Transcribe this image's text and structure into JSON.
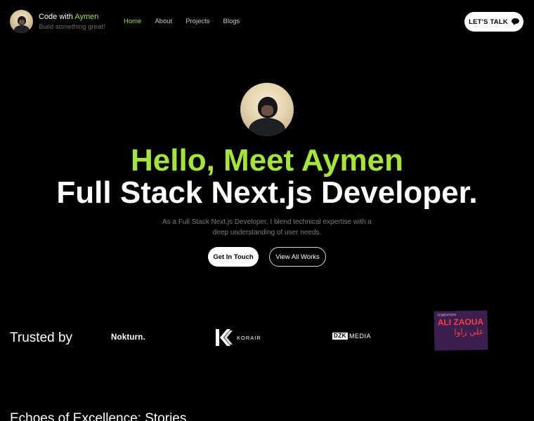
{
  "header": {
    "brand": {
      "prefix": "Code with ",
      "name": "Aymen",
      "tagline": "Build something great!"
    },
    "nav": [
      {
        "label": "Home",
        "active": true
      },
      {
        "label": "About",
        "active": false
      },
      {
        "label": "Projects",
        "active": false
      },
      {
        "label": "Blogs",
        "active": false
      }
    ],
    "cta_label": "LET'S TALK",
    "cta_icon": "chat-icon"
  },
  "hero": {
    "greeting": "Hello, Meet Aymen",
    "role": "Full Stack Next.js Developer.",
    "description": "As a Full Stack Next.js Developer, I blend technical expertise with a deep understanding of user needs.",
    "primary_button": "Get In Touch",
    "secondary_button": "View All Works"
  },
  "trusted": {
    "title": "Trusted by",
    "logos": {
      "nokturn": "Nokturn.",
      "korair": "KORAIR",
      "dzk_mark": "DZK",
      "dzk_word": "MEDIA",
      "ali_top": "FONDATION",
      "ali_main": "ALI ZAOUA",
      "ali_ar": "علي زاوا"
    }
  },
  "next_section": {
    "title": "Echoes of Excellence: Stories"
  },
  "colors": {
    "accent": "#a3e635",
    "background": "#000000",
    "muted": "#7a7a7a"
  }
}
